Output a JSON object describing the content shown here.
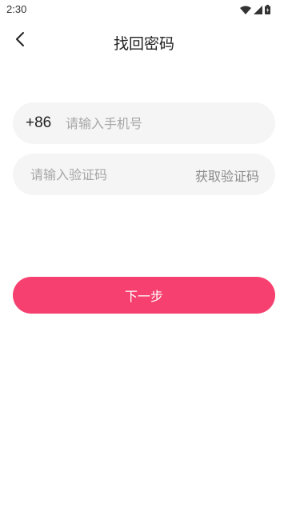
{
  "status_bar": {
    "time": "2:30",
    "icons": [
      "wifi-icon",
      "signal-icon",
      "battery-icon"
    ]
  },
  "header": {
    "title": "找回密码",
    "back_icon": "chevron-left-icon"
  },
  "form": {
    "country_code": "+86",
    "phone_placeholder": "请输入手机号",
    "phone_value": "",
    "code_placeholder": "请输入验证码",
    "code_value": "",
    "get_code_label": "获取验证码"
  },
  "actions": {
    "next_label": "下一步"
  },
  "colors": {
    "accent": "#f6406f",
    "field_background": "#f5f5f5",
    "placeholder": "#a6a6a6"
  }
}
